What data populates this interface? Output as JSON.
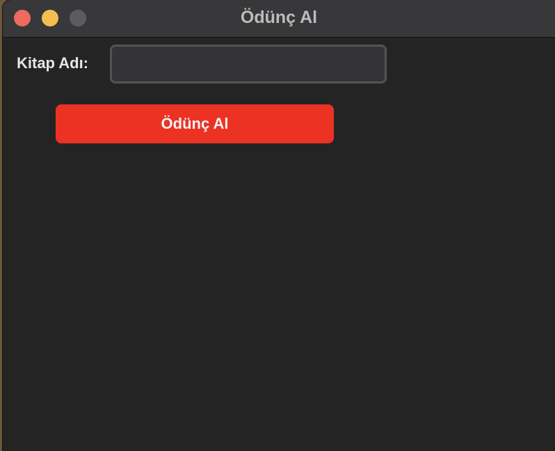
{
  "window": {
    "title": "Ödünç Al"
  },
  "form": {
    "book_label": "Kitap Adı:",
    "book_value": "",
    "book_placeholder": "",
    "submit_label": "Ödünç Al"
  },
  "colors": {
    "accent": "#ec3223",
    "background": "#242424",
    "titlebar": "#383739",
    "close": "#ee6a5e",
    "minimize": "#f5bf4f",
    "maximize": "#5c5c5e"
  },
  "icons": {
    "close": "close-circle-icon",
    "minimize": "minimize-circle-icon",
    "maximize": "zoom-circle-icon"
  }
}
